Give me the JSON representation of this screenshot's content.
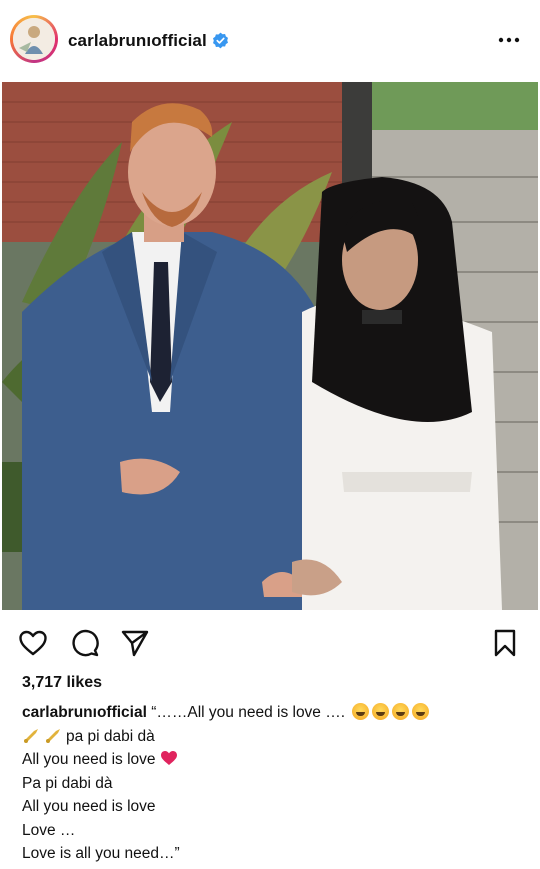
{
  "header": {
    "username": "carlabrunıofficial"
  },
  "actions": {
    "like_icon": "heart-outline-icon",
    "comment_icon": "comment-icon",
    "share_icon": "send-icon",
    "save_icon": "bookmark-icon"
  },
  "likes": "3,717 likes",
  "caption": {
    "username": "carlabrunıofficial",
    "line1": "“……All you need is love ….",
    "line2": "pa pi dabi dà",
    "line3": "All you need is love",
    "line4": "Pa pi dabi dà",
    "line5": "All you need is love",
    "line6": "Love …",
    "line7": "Love is all you need…”"
  },
  "colors": {
    "verified": "#3897f0",
    "heart_emoji": "#e0245e"
  }
}
